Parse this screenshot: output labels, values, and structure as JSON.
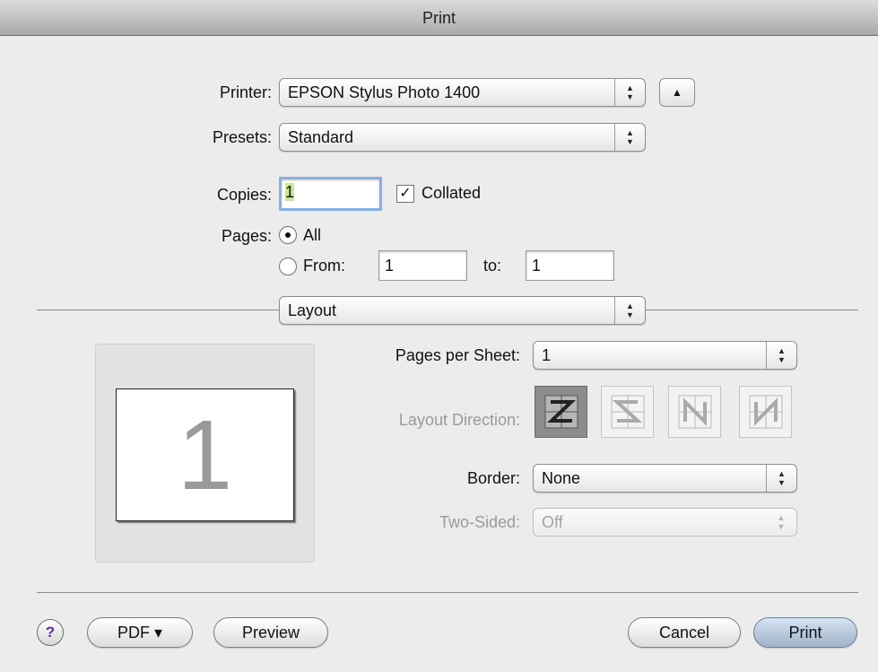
{
  "window": {
    "title": "Print"
  },
  "printer": {
    "label": "Printer:",
    "value": "EPSON Stylus Photo 1400"
  },
  "presets": {
    "label": "Presets:",
    "value": "Standard"
  },
  "copies": {
    "label": "Copies:",
    "value": "1",
    "collated_label": "Collated",
    "collated_checked": true
  },
  "pages": {
    "label": "Pages:",
    "all_label": "All",
    "from_label": "From:",
    "from_value": "1",
    "to_label": "to:",
    "to_value": "1"
  },
  "section": {
    "value": "Layout"
  },
  "preview": {
    "page_number": "1"
  },
  "layout": {
    "pages_per_sheet_label": "Pages per Sheet:",
    "pages_per_sheet_value": "1",
    "direction_label": "Layout Direction:",
    "border_label": "Border:",
    "border_value": "None",
    "two_sided_label": "Two-Sided:",
    "two_sided_value": "Off"
  },
  "footer": {
    "help": "?",
    "pdf": "PDF ▾",
    "preview": "Preview",
    "cancel": "Cancel",
    "print": "Print"
  },
  "icons": {
    "popup_arrows": "up-down-arrows-icon",
    "disclosure": "triangle-up-icon",
    "direction": [
      "z-layout-icon",
      "reverse-z-layout-icon",
      "n-layout-icon",
      "reverse-n-layout-icon"
    ]
  },
  "colors": {
    "focus_ring": "#87b1e6",
    "default_button": "#9fb3c9",
    "help_glyph": "#5b2fa5"
  }
}
